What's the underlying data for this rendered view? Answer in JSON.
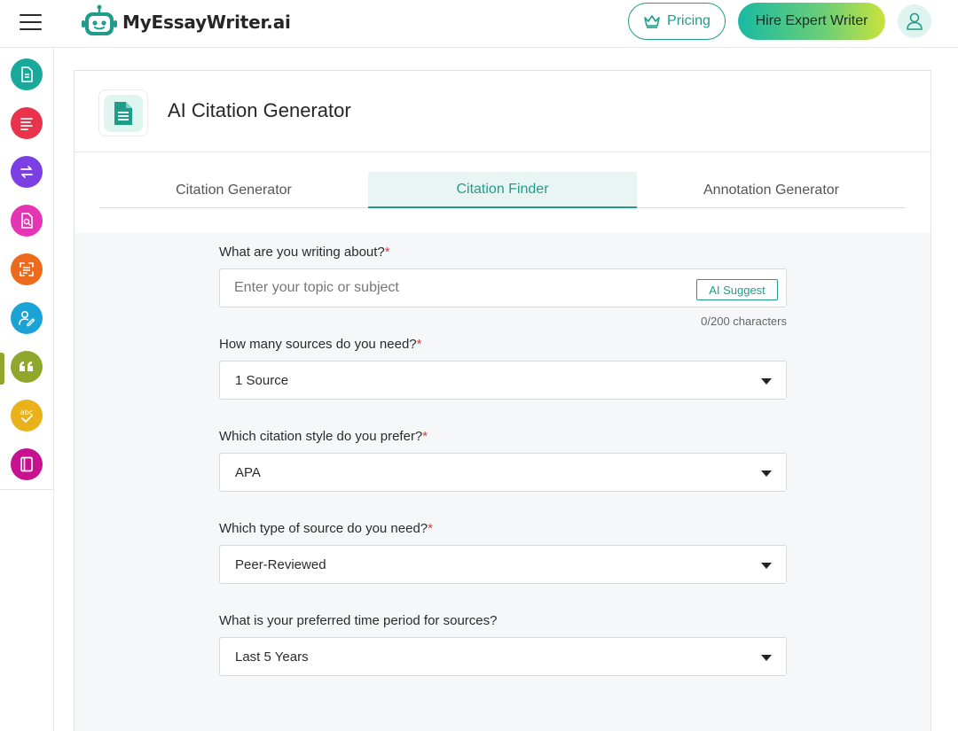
{
  "header": {
    "logo_text": "MyEssayWriter.ai",
    "pricing_label": "Pricing",
    "hire_label": "Hire Expert Writer"
  },
  "sidebar": {
    "items": [
      {
        "icon": "document-icon",
        "color": "#19a99a"
      },
      {
        "icon": "text-lines-icon",
        "color": "#e8334a"
      },
      {
        "icon": "paraphrase-icon",
        "color": "#7b3fe4"
      },
      {
        "icon": "document-search-icon",
        "color": "#e535b5"
      },
      {
        "icon": "scan-text-icon",
        "color": "#ec6a1c"
      },
      {
        "icon": "user-edit-icon",
        "color": "#1aa3d4"
      },
      {
        "icon": "quote-icon",
        "color": "#8fa82c",
        "active": true
      },
      {
        "icon": "spell-check-icon",
        "color": "#e9b21b"
      },
      {
        "icon": "notebook-icon",
        "color": "#c8118f"
      }
    ]
  },
  "page": {
    "title": "AI Citation Generator"
  },
  "tabs": [
    {
      "label": "Citation Generator",
      "active": false
    },
    {
      "label": "Citation Finder",
      "active": true
    },
    {
      "label": "Annotation Generator",
      "active": false
    }
  ],
  "form": {
    "topic": {
      "label": "What are you writing about?",
      "required_mark": "*",
      "placeholder": "Enter your topic or subject",
      "value": "",
      "ai_suggest_label": "AI Suggest",
      "char_count": "0/200 characters"
    },
    "sources": {
      "label": "How many sources do you need?",
      "required_mark": "*",
      "value": "1 Source"
    },
    "style": {
      "label": "Which citation style do you prefer?",
      "required_mark": "*",
      "value": "APA"
    },
    "source_type": {
      "label": "Which type of source do you need?",
      "required_mark": "*",
      "value": "Peer-Reviewed"
    },
    "time_period": {
      "label": "What is your preferred time period for sources?",
      "value": "Last 5 Years"
    }
  },
  "colors": {
    "accent": "#1f9d8a",
    "required": "#e53935",
    "active_tab_bg": "#e8f5f3"
  }
}
